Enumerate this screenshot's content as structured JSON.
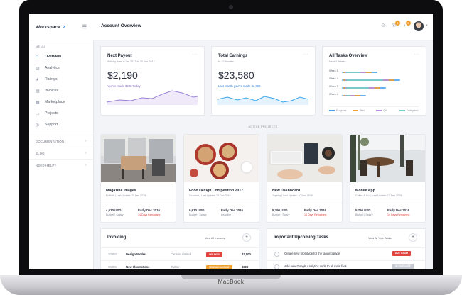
{
  "device": {
    "brand": "MacBook"
  },
  "sidebar": {
    "workspace": "Workspace",
    "section_label": "MENU",
    "items": [
      {
        "label": "Overview",
        "icon": "home-icon",
        "glyph": "⌂"
      },
      {
        "label": "Analytics",
        "icon": "analytics-icon",
        "glyph": "▥"
      },
      {
        "label": "Ratings",
        "icon": "star-icon",
        "glyph": "★"
      },
      {
        "label": "Invoices",
        "icon": "invoice-icon",
        "glyph": "▤"
      },
      {
        "label": "Marketplace",
        "icon": "store-icon",
        "glyph": "▦"
      },
      {
        "label": "Projects",
        "icon": "folder-icon",
        "glyph": "▭"
      },
      {
        "label": "Support",
        "icon": "support-icon",
        "glyph": "◎"
      }
    ],
    "groups": [
      "DOCUMENTATION",
      "BLOG",
      "NEED HELP?"
    ]
  },
  "header": {
    "title": "Account Overview"
  },
  "next_payout": {
    "title": "Next Payout",
    "subtitle": "Activity from 4 Jan 2017 to 20 Jan 2017",
    "amount": "$2,190",
    "note": "You've made $230 Today"
  },
  "total_earnings": {
    "title": "Total Earnings",
    "subtitle": "In 12 Months",
    "amount": "$23,580",
    "note": "Last Month you've made $2,988"
  },
  "all_tasks": {
    "title": "All Tasks Overview",
    "subtitle": "Next 4 Weeks",
    "weeks": [
      "Week 1",
      "Week 4",
      "Week 3",
      "Week 4"
    ],
    "legend": [
      "Progress",
      "Test",
      "QA",
      "Delegated"
    ],
    "colors": [
      "#4aa3f0",
      "#f0a030",
      "#b48ee6",
      "#6fd3c8"
    ]
  },
  "active_projects_label": "ACTIVE PROJECTS",
  "projects": [
    {
      "title": "Magazine Images",
      "meta": "Rollfolk  |  Last Update: 11 Dec 2016",
      "budget": "4,670 USD",
      "budget_label": "Budget | Salary",
      "date": "Early Dec 2016",
      "date_label": "14 Days Remaining"
    },
    {
      "title": "Food Design Competition 2017",
      "meta": "Gourmet  |  Last Update: 26 Dec 2016",
      "budget": "9,630 USD",
      "budget_label": "Budget | Salary",
      "date": "Early Dec 2016",
      "date_label": "Deadline"
    },
    {
      "title": "New Dashboard",
      "meta": "Topsley  |  Last Update: 10 Dec 2016",
      "budget": "5,790 USD",
      "budget_label": "Budget | Salary",
      "date": "Early Dec 2016",
      "date_label": "14 Days Remaining"
    },
    {
      "title": "Mobile App",
      "meta": "Coffee & Co.  |  Last Update: 13 Dec 2016",
      "budget": "5,760 USD",
      "budget_label": "Budget | Salary",
      "date": "Early Dec 2016",
      "date_label": "14 Days Remaining"
    }
  ],
  "invoicing": {
    "title": "Invoicing",
    "view_all": "View All Invoices",
    "rows": [
      {
        "id": "30450",
        "name": "Design Works",
        "client": "Carlson Limited",
        "status": "DELAYED",
        "status_color": "#e0463f",
        "amount": "$2,500"
      },
      {
        "id": "30459",
        "name": "New Illustrations",
        "client": "Twitter",
        "status": "PENDING INVOICE",
        "status_color": "#f0a030",
        "amount": "$900"
      }
    ]
  },
  "upcoming": {
    "title": "Important Upcoming Tasks",
    "view_all": "View All Your Tasks",
    "rows": [
      {
        "text": "Create new prototype for the landing page",
        "tag": "DUE TODAY",
        "tag_color": "#e0463f"
      },
      {
        "text": "Add new Google Analytics code to all main files",
        "tag": "NO DUE DATE",
        "tag_color": "#c5c9d2"
      }
    ]
  }
}
